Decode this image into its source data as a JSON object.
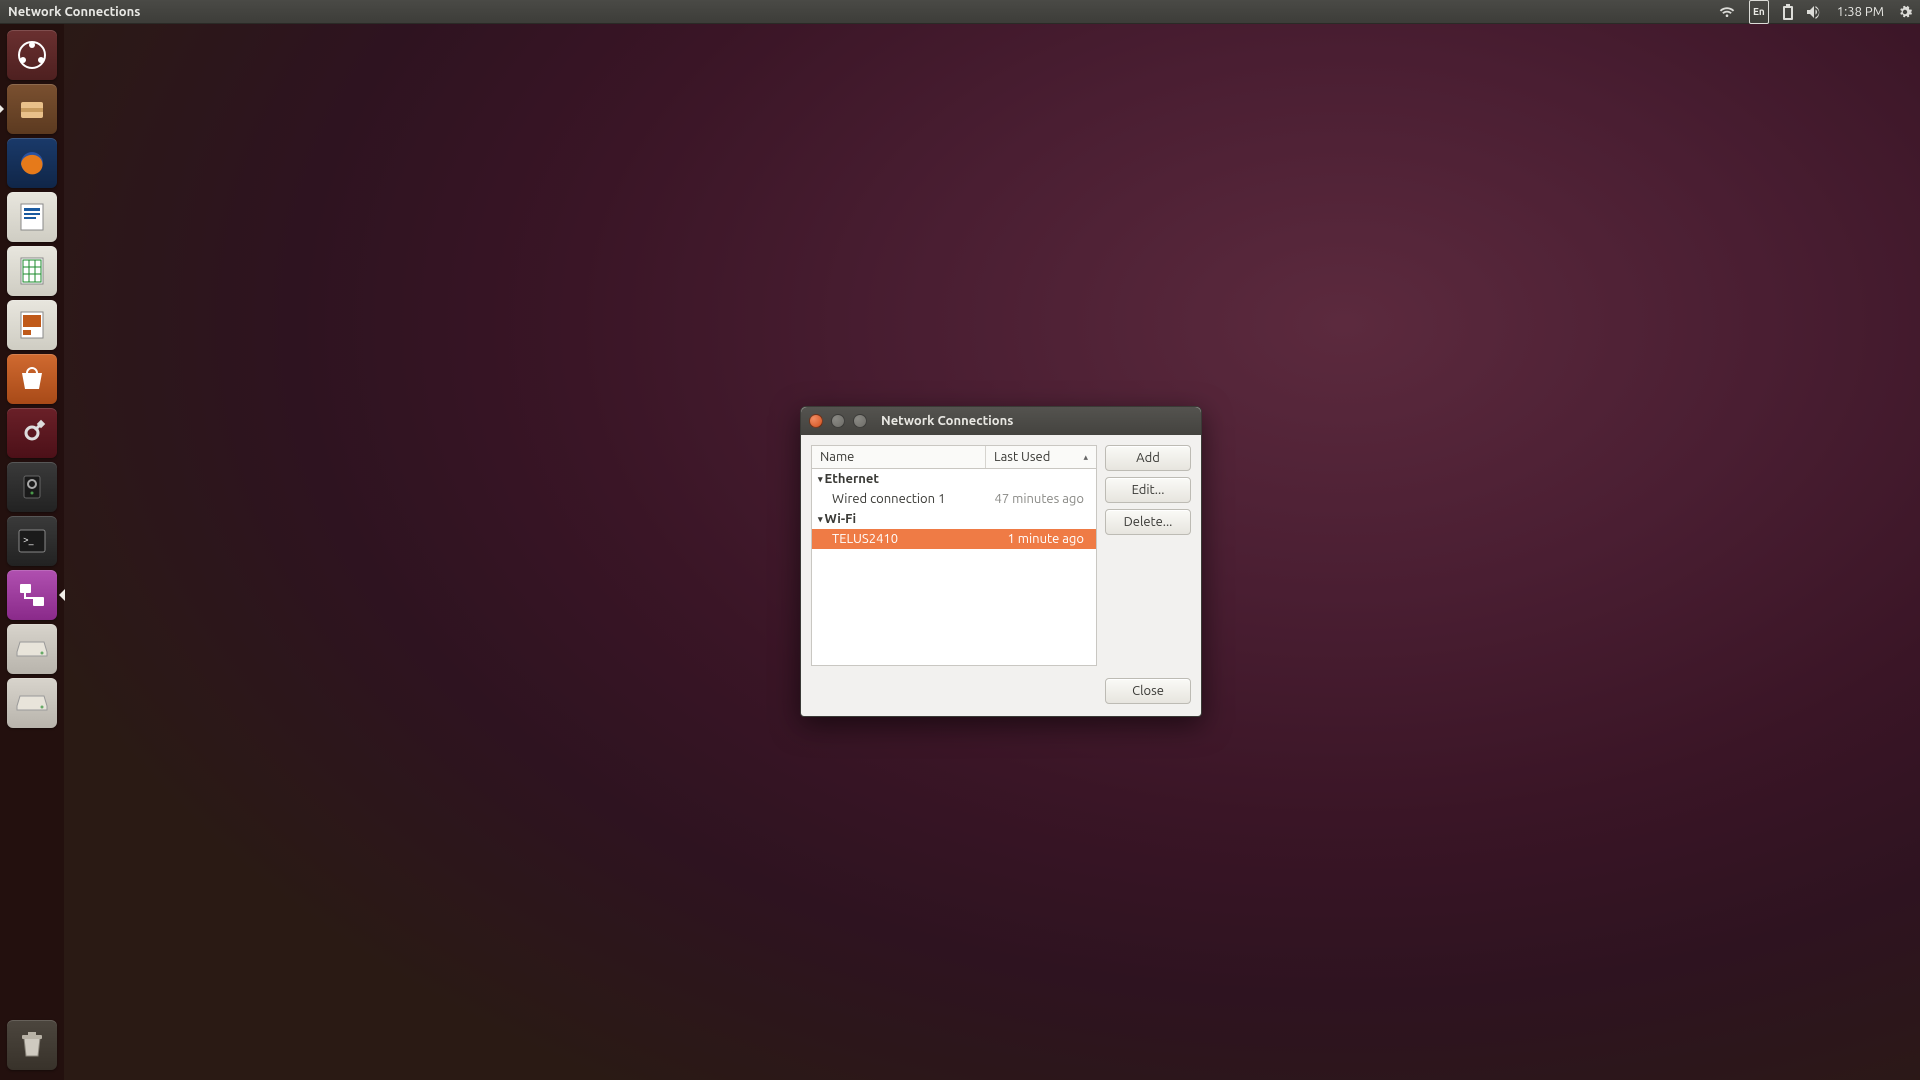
{
  "menubar": {
    "app_title": "Network Connections",
    "language": "En",
    "clock": "1:38 PM"
  },
  "launcher": {
    "items": [
      {
        "name": "ubuntu-dash",
        "label": "Dash"
      },
      {
        "name": "files",
        "label": "Files",
        "running": true
      },
      {
        "name": "firefox",
        "label": "Firefox"
      },
      {
        "name": "writer",
        "label": "LibreOffice Writer"
      },
      {
        "name": "calc",
        "label": "LibreOffice Calc"
      },
      {
        "name": "impress",
        "label": "LibreOffice Impress"
      },
      {
        "name": "software",
        "label": "Ubuntu Software"
      },
      {
        "name": "settings",
        "label": "System Settings"
      },
      {
        "name": "backup",
        "label": "Backup"
      },
      {
        "name": "terminal",
        "label": "Terminal"
      },
      {
        "name": "network",
        "label": "Network Connections",
        "active": true
      },
      {
        "name": "drive1",
        "label": "Mounted Drive"
      },
      {
        "name": "drive2",
        "label": "Mounted Drive"
      }
    ],
    "trash_label": "Trash"
  },
  "dialog": {
    "title": "Network Connections",
    "columns": {
      "name": "Name",
      "last_used": "Last Used"
    },
    "groups": [
      {
        "label": "Ethernet",
        "rows": [
          {
            "name": "Wired connection 1",
            "last_used": "47 minutes ago",
            "selected": false
          }
        ]
      },
      {
        "label": "Wi-Fi",
        "rows": [
          {
            "name": "TELUS2410",
            "last_used": "1 minute ago",
            "selected": true
          }
        ]
      }
    ],
    "buttons": {
      "add": "Add",
      "edit": "Edit...",
      "delete": "Delete...",
      "close": "Close"
    }
  }
}
